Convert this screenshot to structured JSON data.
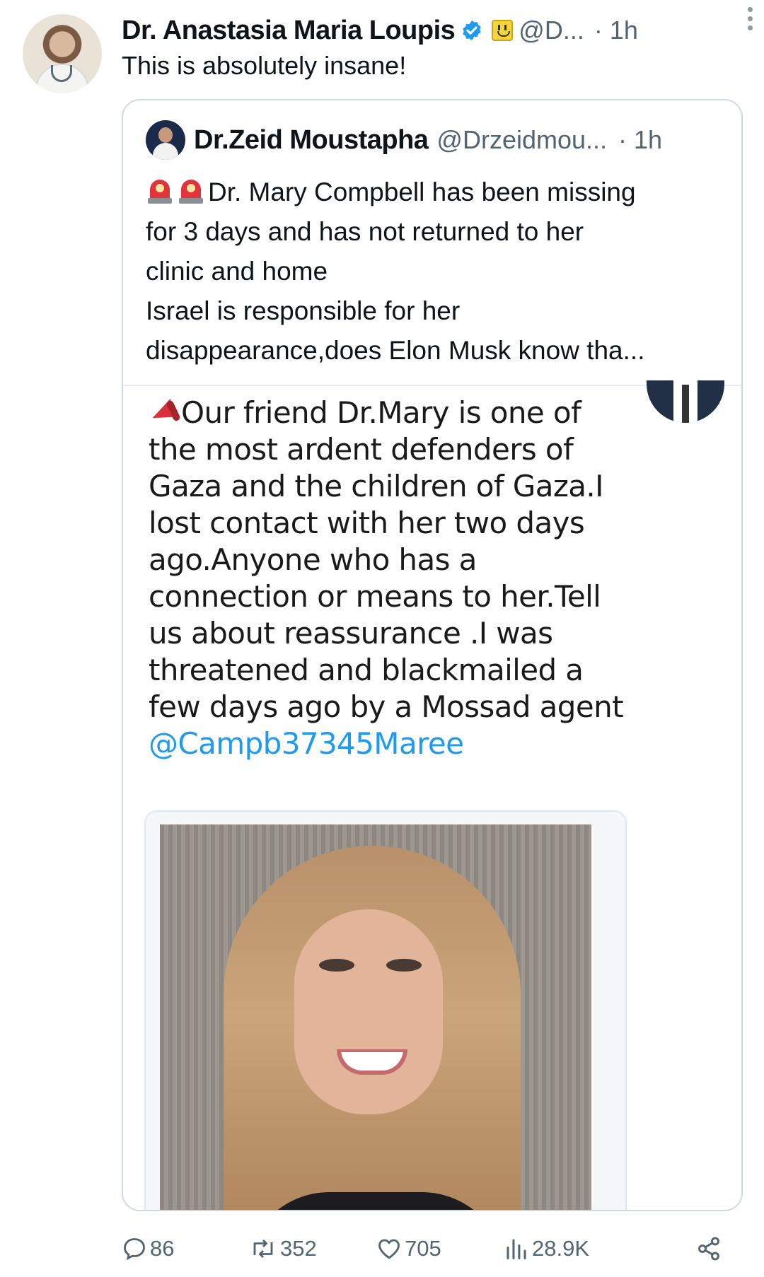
{
  "tweet": {
    "author_name": "Dr. Anastasia Maria Loupis",
    "author_handle": "@D...",
    "time": "· 1h",
    "text": "This is absolutely insane!",
    "icons": [
      "verified-icon",
      "emoji-badge-icon",
      "more-icon"
    ]
  },
  "quote": {
    "author_name": "Dr.Zeid Moustapha",
    "author_handle": "@Drzeidmou...",
    "time": "· 1h",
    "lines": [
      "Dr. Mary Compbell has been missing",
      "for 3 days and has not returned to her",
      "clinic and home",
      "Israel is responsible for her",
      "disappearance,does Elon Musk know tha..."
    ],
    "screenshot": {
      "lines": [
        "Our friend Dr.Mary is one of",
        "the most ardent defenders of",
        "Gaza and the children of Gaza.I",
        "lost contact with her two days",
        "ago.Anyone who has a",
        "connection or means to her.Tell",
        "us about reassurance .I was",
        "threatened and blackmailed a",
        "few days ago by a Mossad agent"
      ],
      "mention": "@Campb37345Maree"
    }
  },
  "actions": {
    "replies": "86",
    "reposts": "352",
    "likes": "705",
    "views": "28.9K"
  },
  "colors": {
    "text": "#0f1419",
    "secondary": "#536471",
    "link": "#1d9bf0",
    "verified": "#1d9bf0",
    "border": "#cfd9de"
  }
}
